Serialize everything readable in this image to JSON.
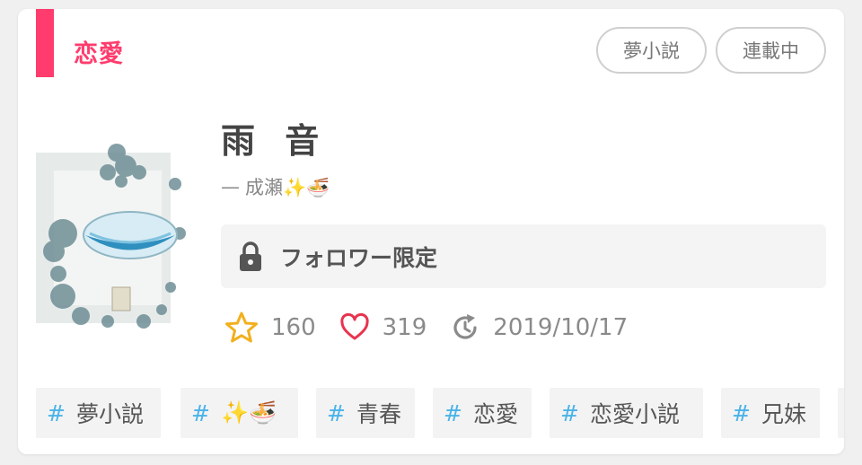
{
  "genre": {
    "label": "恋愛",
    "color": "#ff3c6d"
  },
  "badges": [
    "夢小説",
    "連載中"
  ],
  "work": {
    "title": "雨 音",
    "author_prefix": "—",
    "author": "成瀬✨🍜",
    "access_notice": "フォロワー限定"
  },
  "stats": {
    "stars": "160",
    "hearts": "319",
    "updated": "2019/10/17"
  },
  "tags": [
    {
      "hash": "#",
      "label": "夢小説"
    },
    {
      "hash": "#",
      "label": "✨🍜"
    },
    {
      "hash": "#",
      "label": "青春"
    },
    {
      "hash": "#",
      "label": "恋愛"
    },
    {
      "hash": "#",
      "label": "恋愛小説"
    },
    {
      "hash": "#",
      "label": "兄妹"
    }
  ],
  "icons": {
    "star": "star-icon",
    "heart": "heart-icon",
    "updated": "clock-refresh-icon",
    "lock": "lock-icon"
  },
  "colors": {
    "accent": "#ff3c6d",
    "star": "#f2b01e",
    "heart": "#e8344f",
    "tag_hash": "#4ab3e8"
  }
}
